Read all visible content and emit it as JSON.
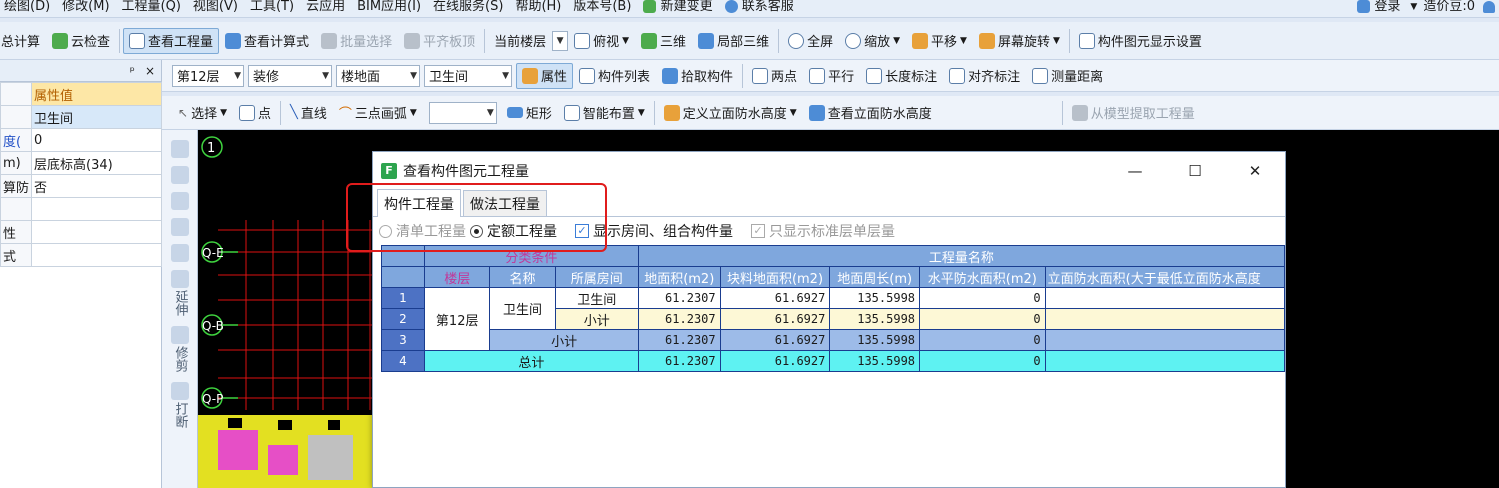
{
  "menubar": {
    "items": [
      "绘图(D)",
      "修改(M)",
      "工程量(Q)",
      "视图(V)",
      "工具(T)",
      "云应用",
      "BIM应用(I)",
      "在线服务(S)",
      "帮助(H)",
      "版本号(B)",
      "新建变更",
      "联系客服"
    ],
    "login": "登录",
    "price_beans": "造价豆:0"
  },
  "toolbar1": {
    "items": [
      "总计算",
      "云检查",
      "查看工程量",
      "查看计算式",
      "批量选择",
      "平齐板顶",
      "当前楼层",
      "俯视",
      "三维",
      "局部三维",
      "全屏",
      "缩放",
      "平移",
      "屏幕旋转",
      "构件图元显示设置"
    ]
  },
  "toolbar2": {
    "floor": "第12层",
    "category": "装修",
    "type": "楼地面",
    "component": "卫生间",
    "items": [
      "属性",
      "构件列表",
      "拾取构件",
      "两点",
      "平行",
      "长度标注",
      "对齐标注",
      "测量距离"
    ]
  },
  "toolbar3": {
    "items": [
      "选择",
      "点",
      "直线",
      "三点画弧",
      "矩形",
      "智能布置",
      "定义立面防水高度",
      "查看立面防水高度",
      "从模型提取工程量"
    ]
  },
  "left_panel": {
    "pin": "ᵖ",
    "close": "×",
    "header_value": "属性值",
    "rows": [
      {
        "key": "",
        "value": "卫生间"
      },
      {
        "key": "度(",
        "value": "0"
      },
      {
        "key": "m)",
        "value": "层底标高(34)"
      },
      {
        "key": "算防",
        "value": "否"
      },
      {
        "key": "",
        "value": ""
      },
      {
        "key": "性",
        "value": ""
      },
      {
        "key": "式",
        "value": ""
      }
    ]
  },
  "vertical_toolbar": {
    "items": [
      "延伸",
      "修剪",
      "打断"
    ]
  },
  "canvas": {
    "axis_labels": [
      "1",
      "Q-E",
      "Q-B",
      "Q-P"
    ]
  },
  "dialog": {
    "title": "查看构件图元工程量",
    "tabs": [
      "构件工程量",
      "做法工程量"
    ],
    "options": {
      "radio_list": "清单工程量",
      "radio_quota": "定额工程量",
      "check_rooms": "显示房间、组合构件量",
      "check_standard": "只显示标准层单层量"
    },
    "table": {
      "group_header": "分类条件",
      "quantity_header": "工程量名称",
      "columns": [
        "楼层",
        "名称",
        "所属房间",
        "地面积(m2)",
        "块料地面积(m2)",
        "地面周长(m)",
        "水平防水面积(m2)",
        "立面防水面积(大于最低立面防水高度"
      ],
      "floor": "第12层",
      "name": "卫生间",
      "row_numbers": [
        "1",
        "2",
        "3",
        "4"
      ],
      "rows": [
        {
          "room": "卫生间",
          "area": "61.2307",
          "block_area": "61.6927",
          "perimeter": "135.5998",
          "h_waterproof": "0"
        },
        {
          "room": "小计",
          "area": "61.2307",
          "block_area": "61.6927",
          "perimeter": "135.5998",
          "h_waterproof": "0"
        },
        {
          "label": "小计",
          "area": "61.2307",
          "block_area": "61.6927",
          "perimeter": "135.5998",
          "h_waterproof": "0"
        },
        {
          "label": "总计",
          "area": "61.2307",
          "block_area": "61.6927",
          "perimeter": "135.5998",
          "h_waterproof": "0"
        }
      ]
    }
  },
  "annotation": {
    "color": "#e01c1c"
  }
}
